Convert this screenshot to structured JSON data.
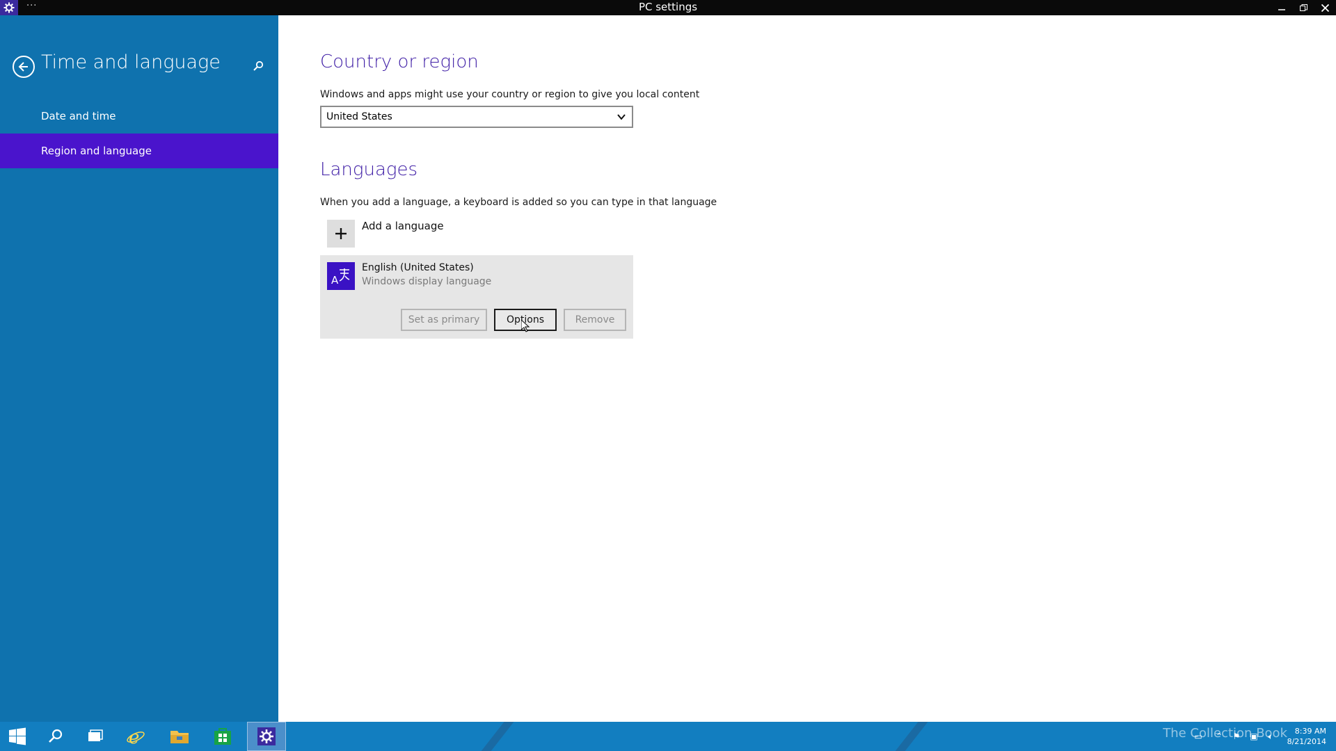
{
  "window": {
    "title": "PC settings",
    "menu_dots": "···",
    "controls": [
      "minimize-icon",
      "restore-icon",
      "close-icon"
    ]
  },
  "sidebar": {
    "title": "Time and language",
    "items": [
      {
        "label": "Date and time",
        "active": false
      },
      {
        "label": "Region and language",
        "active": true
      }
    ],
    "color": "#0f72ae",
    "active_color": "#4a14cc"
  },
  "country": {
    "heading": "Country or region",
    "description": "Windows and apps might use your country or region to give you local content",
    "selected": "United States"
  },
  "languages": {
    "heading": "Languages",
    "description": "When you add a language, a keyboard is added so you can type in that language",
    "add_label": "Add a language",
    "entries": [
      {
        "name": "English (United States)",
        "subtitle": "Windows display language",
        "buttons": {
          "set_primary": "Set as primary",
          "options": "Options",
          "remove": "Remove"
        }
      }
    ]
  },
  "taskbar": {
    "apps": [
      "windows-start-icon",
      "search-icon",
      "task-view-icon",
      "internet-explorer-icon",
      "file-explorer-icon",
      "store-icon",
      "settings-icon"
    ],
    "active_app": "settings-icon",
    "watermark": "The Collection Book",
    "clock_time": "8:39 AM",
    "clock_date": "8/21/2014"
  },
  "colors": {
    "heading": "#3f1ea6",
    "accent_purple": "#3a12c4",
    "taskbar": "#127ec0"
  }
}
